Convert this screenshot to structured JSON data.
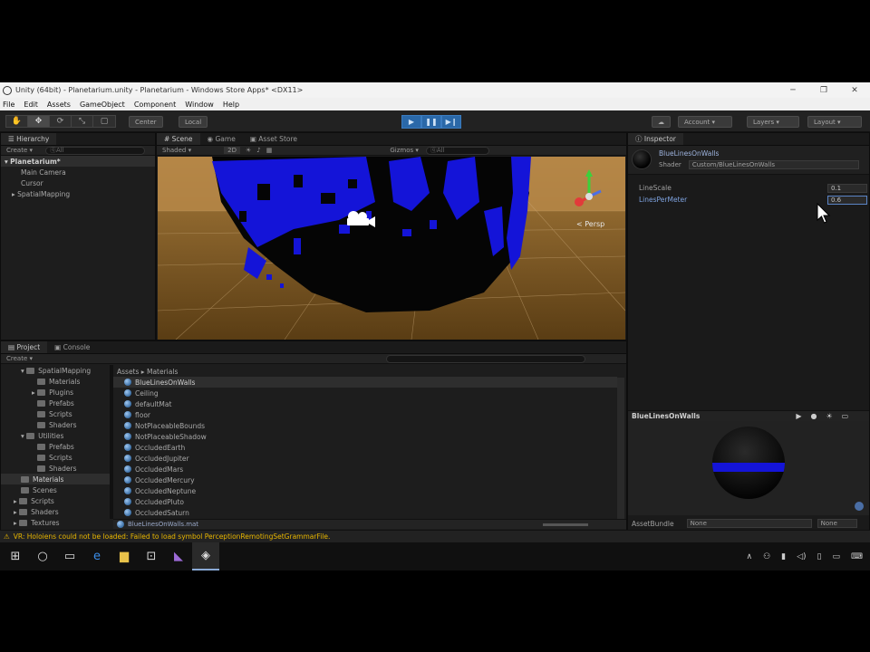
{
  "window": {
    "title": "Unity (64bit) - Planetarium.unity - Planetarium - Windows Store Apps* <DX11>",
    "minimize": "─",
    "maximize": "❐",
    "close": "✕"
  },
  "menu": [
    "File",
    "Edit",
    "Assets",
    "GameObject",
    "Component",
    "Window",
    "Help"
  ],
  "toolbar": {
    "pivot": "Center",
    "space": "Local",
    "account": "Account",
    "layers": "Layers",
    "layout": "Layout"
  },
  "hierarchy": {
    "tab": "Hierarchy",
    "create": "Create",
    "search_placeholder": "ⓠAll",
    "scene": "Planetarium*",
    "items": [
      "Main Camera",
      "Cursor",
      "SpatialMapping"
    ]
  },
  "scene_tabs": {
    "scene": "Scene",
    "game": "Game",
    "asset_store": "Asset Store",
    "shading": "Shaded",
    "mode_2d": "2D",
    "gizmos": "Gizmos",
    "search_placeholder": "ⓠAll",
    "persp": "< Persp"
  },
  "project": {
    "tab": "Project",
    "console_tab": "Console",
    "create": "Create",
    "tree": [
      {
        "label": "SpatialMapping",
        "depth": 1
      },
      {
        "label": "Materials",
        "depth": 2
      },
      {
        "label": "Plugins",
        "depth": 2
      },
      {
        "label": "Prefabs",
        "depth": 2
      },
      {
        "label": "Scripts",
        "depth": 2
      },
      {
        "label": "Shaders",
        "depth": 2
      },
      {
        "label": "Utilities",
        "depth": 1
      },
      {
        "label": "Prefabs",
        "depth": 2
      },
      {
        "label": "Scripts",
        "depth": 2
      },
      {
        "label": "Shaders",
        "depth": 2
      },
      {
        "label": "Materials",
        "depth": 0
      },
      {
        "label": "Scenes",
        "depth": 0
      },
      {
        "label": "Scripts",
        "depth": 0
      },
      {
        "label": "Shaders",
        "depth": 0
      },
      {
        "label": "Textures",
        "depth": 0
      }
    ],
    "breadcrumb": [
      "Assets",
      "Materials"
    ],
    "files": [
      "BlueLinesOnWalls",
      "Ceiling",
      "defaultMat",
      "floor",
      "NotPlaceableBounds",
      "NotPlaceableShadow",
      "OccludedEarth",
      "OccludedJupiter",
      "OccludedMars",
      "OccludedMercury",
      "OccludedNeptune",
      "OccludedPluto",
      "OccludedSaturn"
    ],
    "footer_path": "BlueLinesOnWalls.mat"
  },
  "inspector": {
    "tab": "Inspector",
    "material_name": "BlueLinesOnWalls",
    "shader_label": "Shader",
    "shader_value": "Custom/BlueLinesOnWalls",
    "props": [
      {
        "label": "LineScale",
        "value": "0.1"
      },
      {
        "label": "LinesPerMeter",
        "value": "0.6"
      }
    ],
    "preview_title": "BlueLinesOnWalls",
    "assetbundle_label": "AssetBundle",
    "assetbundle_value": "None",
    "assetbundle_variant": "None"
  },
  "status": {
    "message": "VR: Holoiens could not be loaded: Failed to load symbol PerceptionRemotingSetGrammarFile."
  },
  "taskbar": {
    "icons": [
      "windows-start",
      "cortana",
      "task-view",
      "edge",
      "file-explorer",
      "store",
      "visual-studio",
      "unity"
    ]
  },
  "colors": {
    "accent": "#2a68a8",
    "mesh": "#1414d8",
    "warning": "#e8b600"
  }
}
